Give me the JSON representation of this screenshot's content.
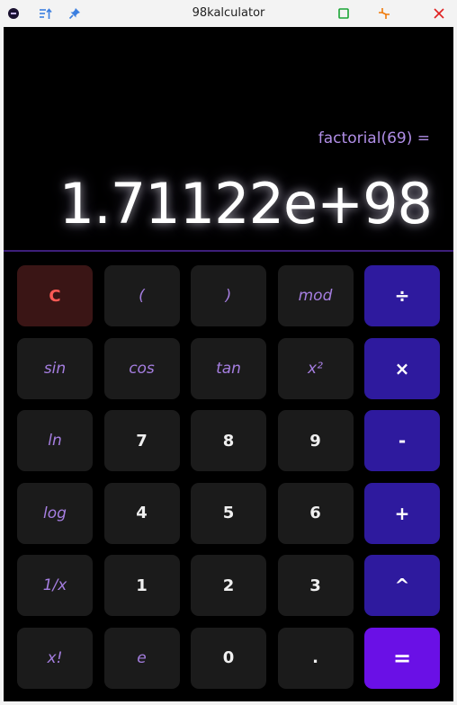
{
  "window": {
    "title": "98kalculator"
  },
  "display": {
    "expression": "factorial(69) =",
    "result": "1.71122e+98"
  },
  "icons": {
    "app": "app-logo-icon",
    "sort": "sort-up-icon",
    "pin": "pin-icon",
    "maximize": "maximize-icon",
    "restore": "restore-icon",
    "close": "close-icon"
  },
  "colors": {
    "accent_expression": "#b08ee6",
    "operator_key": "#2e1a9e",
    "equals_key": "#6a10e6",
    "clear_text": "#ff5a55",
    "divider": "#3d1f7a"
  },
  "keys": [
    {
      "label": "C",
      "kind": "clear"
    },
    {
      "label": "(",
      "kind": "fn"
    },
    {
      "label": ")",
      "kind": "fn"
    },
    {
      "label": "mod",
      "kind": "fn"
    },
    {
      "label": "÷",
      "kind": "op"
    },
    {
      "label": "sin",
      "kind": "fn"
    },
    {
      "label": "cos",
      "kind": "fn"
    },
    {
      "label": "tan",
      "kind": "fn"
    },
    {
      "label": "x²",
      "kind": "fn"
    },
    {
      "label": "×",
      "kind": "op"
    },
    {
      "label": "ln",
      "kind": "fn"
    },
    {
      "label": "7",
      "kind": "num"
    },
    {
      "label": "8",
      "kind": "num"
    },
    {
      "label": "9",
      "kind": "num"
    },
    {
      "label": "-",
      "kind": "op"
    },
    {
      "label": "log",
      "kind": "fn"
    },
    {
      "label": "4",
      "kind": "num"
    },
    {
      "label": "5",
      "kind": "num"
    },
    {
      "label": "6",
      "kind": "num"
    },
    {
      "label": "+",
      "kind": "op"
    },
    {
      "label": "1/x",
      "kind": "fn"
    },
    {
      "label": "1",
      "kind": "num"
    },
    {
      "label": "2",
      "kind": "num"
    },
    {
      "label": "3",
      "kind": "num"
    },
    {
      "label": "^",
      "kind": "op"
    },
    {
      "label": "x!",
      "kind": "fn"
    },
    {
      "label": "e",
      "kind": "fn"
    },
    {
      "label": "0",
      "kind": "num"
    },
    {
      "label": ".",
      "kind": "num"
    },
    {
      "label": "=",
      "kind": "eq"
    }
  ]
}
